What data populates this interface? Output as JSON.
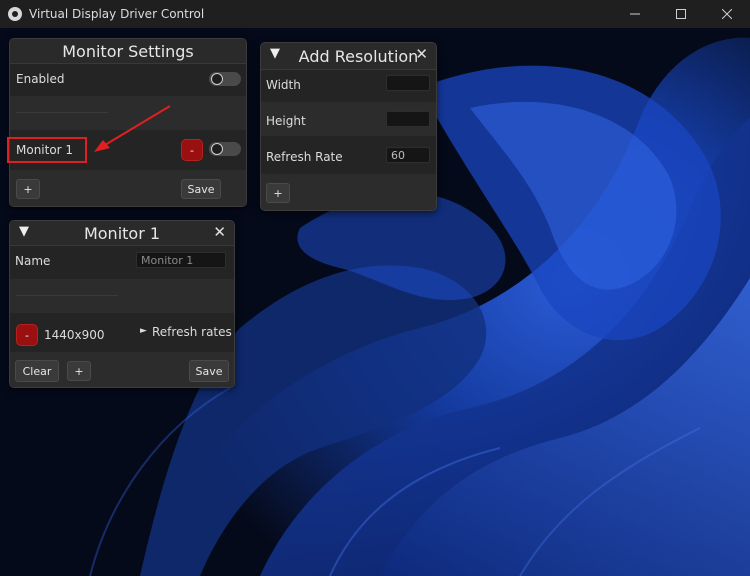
{
  "window": {
    "title": "Virtual Display Driver Control",
    "minimize_icon": "minimize-icon",
    "maximize_icon": "maximize-icon",
    "close_icon": "close-icon"
  },
  "monitor_settings": {
    "title": "Monitor Settings",
    "enabled_label": "Enabled",
    "enabled_state": "off",
    "monitor_name": "Monitor 1",
    "remove_label": "-",
    "monitor_toggle_state": "off",
    "add_label": "+",
    "save_label": "Save"
  },
  "add_resolution": {
    "title": "Add Resolution",
    "collapse_icon": "▼",
    "close_icon": "✕",
    "width_label": "Width",
    "width_value": "",
    "height_label": "Height",
    "height_value": "",
    "refresh_label": "Refresh Rate",
    "refresh_value": "60",
    "add_label": "+"
  },
  "monitor1": {
    "title": "Monitor 1",
    "collapse_icon": "▼",
    "close_icon": "✕",
    "name_label": "Name",
    "name_placeholder": "Monitor 1",
    "remove_label": "-",
    "resolution": "1440x900",
    "refresh_rates_label": "Refresh rates",
    "refresh_rates_arrow": "►",
    "clear_label": "Clear",
    "add_label": "+",
    "save_label": "Save"
  },
  "annotation": {
    "highlight_color": "#e02020"
  },
  "colors": {
    "panel_bg": "#242424",
    "remove_button": "#9a1010",
    "titlebar": "#1f1f1f"
  }
}
